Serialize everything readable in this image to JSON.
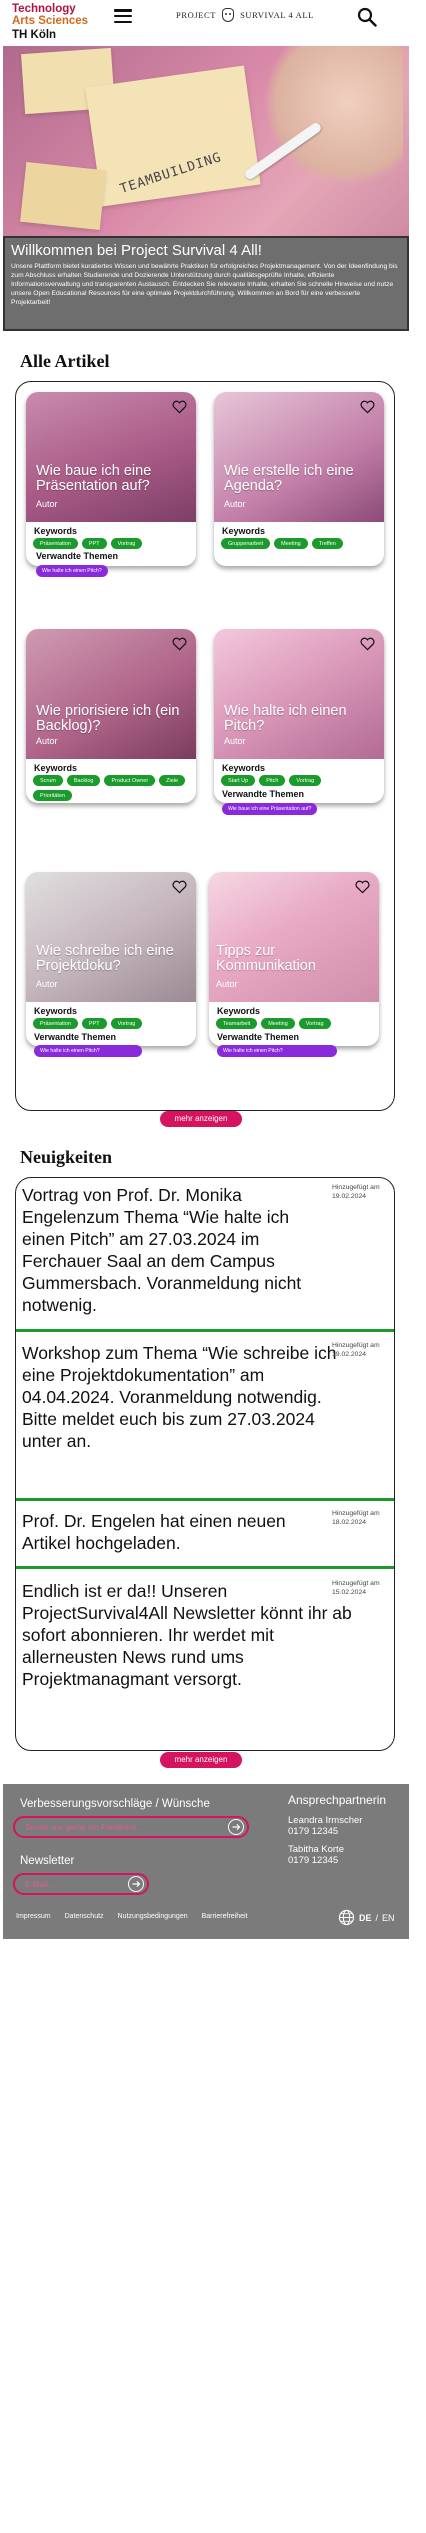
{
  "header": {
    "logo_line1": "Technology",
    "logo_line2": "Arts Sciences",
    "logo_line3": "TH Köln",
    "brand_left": "PROJECT",
    "brand_right": "SURVIVAL 4 ALL"
  },
  "hero": {
    "image_text": "TEAMBUILDING",
    "title": "Willkommen bei Project Survival 4 All!",
    "description": "Unsere Plattform bietet kuratiertes Wissen und bewährte Praktiken für erfolgreiches Projektmanagement. Von der Ideenfindung bis zum Abschluss erhalten Studierende und Dozierende Unterstützung durch qualitätsgeprüfte Inhalte, effiziente Informationsverwaltung und transparenten Austausch. Entdecken Sie relevante Inhalte, erhalten Sie schnelle Hinweise und nutze unsere Open Educational Resources für eine optimale Projektdurchführung. Willkommen an Bord für eine verbesserte Projektarbeit!"
  },
  "articles": {
    "heading": "Alle Artikel",
    "keywords_label": "Keywords",
    "related_label": "Verwandte Themen",
    "more_label": "mehr anzeigen",
    "cards": [
      {
        "title": "Wie baue ich eine Präsentation auf?",
        "author": "Autor",
        "keywords": [
          "Präsentation",
          "PPT",
          "Vortrag"
        ],
        "related": "Wie halte ich einen Pitch?"
      },
      {
        "title": "Wie erstelle ich eine Agenda?",
        "author": "Autor",
        "keywords": [
          "Gruppenarbeit",
          "Meeting",
          "Treffen"
        ],
        "related": ""
      },
      {
        "title": "Wie priorisiere ich (ein Backlog)?",
        "author": "Autor",
        "keywords": [
          "Scrum",
          "Backlog",
          "Product Owner",
          "Ziele",
          "Prioritäten"
        ],
        "related": ""
      },
      {
        "title": "Wie halte ich einen Pitch?",
        "author": "Autor",
        "keywords": [
          "Start Up",
          "Pitch",
          "Vortrag"
        ],
        "related": "Wie baue ich eine Präsentation auf?"
      },
      {
        "title": "Wie schreibe ich eine Projektdoku?",
        "author": "Autor",
        "keywords": [
          "Präsentation",
          "PPT",
          "Vortrag"
        ],
        "related": "Wie halte ich einen Pitch?"
      },
      {
        "title": "Tipps zur Kommunikation",
        "author": "Autor",
        "keywords": [
          "Teamarbeit",
          "Meeting",
          "Vortrag"
        ],
        "related": "Wie halte ich einen Pitch?"
      }
    ]
  },
  "news": {
    "heading": "Neuigkeiten",
    "added_label": "Hinzugefügt am",
    "more_label": "mehr anzeigen",
    "items": [
      {
        "text": "Vortrag von Prof. Dr. Monika Engelenzum Thema “Wie halte ich einen Pitch” am 27.03.2024 im Ferchauer Saal an dem Campus Gummersbach. Voranmeldung nicht notwenig.",
        "date": "19.02.2024"
      },
      {
        "text": "Workshop zum Thema “Wie schreibe ich eine Projektdokumentation” am 04.04.2024. Voranmeldung notwendig. Bitte meldet euch bis zum 27.03.2024 unter  an.",
        "date": "19.02.2024"
      },
      {
        "text": "Prof. Dr. Engelen hat einen neuen Artikel hochgeladen.",
        "date": "18.02.2024"
      },
      {
        "text": "Endlich ist er da!! Unseren ProjectSurvival4All Newsletter könnt ihr ab sofort abonnieren. Ihr werdet mit allerneusten News rund ums Projektmanagmant versorgt.",
        "date": "15.02.2024"
      }
    ]
  },
  "footer": {
    "feedback_heading": "Verbesserungsvorschläge / Wünsche",
    "feedback_placeholder": "Sende uns gerne ein Feedback ...",
    "newsletter_heading": "Newsletter",
    "newsletter_placeholder": "E-Mail ...",
    "contact_heading": "Ansprechpartnerin",
    "contact1_name": "Leandra Irmscher",
    "contact1_phone": "0179 12345",
    "contact2_name": "Tabitha Korte",
    "contact2_phone": "0179 12345",
    "links": [
      "Impressum",
      "Datenschutz",
      "Nutzungsbedingungen",
      "Barrierefreiheit"
    ],
    "lang_de": "DE",
    "lang_sep": "/",
    "lang_en": "EN"
  },
  "colors": {
    "accent": "#d5135f",
    "chip_green": "#1a9b2c",
    "related_purple": "#8a2bdb",
    "footer_gray": "#7b7b7b"
  }
}
